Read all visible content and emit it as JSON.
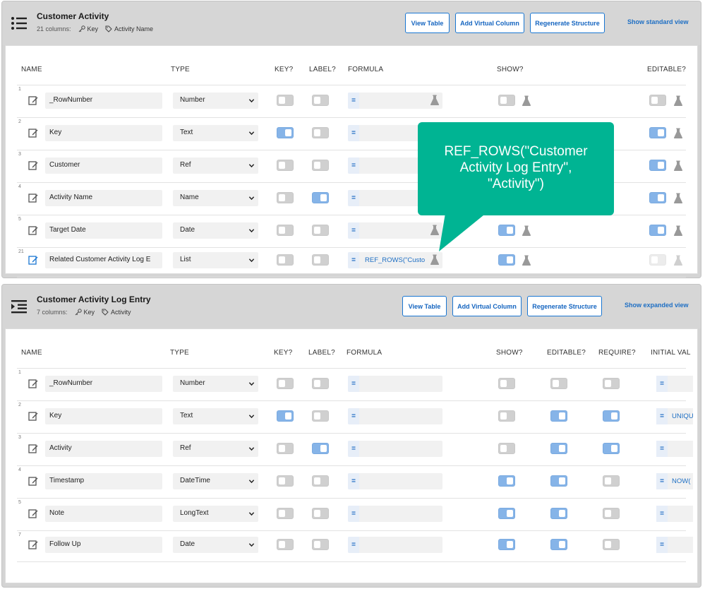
{
  "tables": [
    {
      "title": "Customer Activity",
      "columns_count": "21 columns:",
      "key_label": "Key",
      "label_label": "Activity Name",
      "buttons": {
        "view_table": "View Table",
        "add_virtual": "Add Virtual Column",
        "regenerate": "Regenerate Structure"
      },
      "toggle_view_link": "Show standard view",
      "headers": {
        "name": "NAME",
        "type": "TYPE",
        "key": "KEY?",
        "label": "LABEL?",
        "formula": "FORMULA",
        "show": "SHOW?",
        "editable": "EDITABLE?"
      },
      "rows": [
        {
          "num": "1",
          "name": "_RowNumber",
          "type": "Number",
          "key": false,
          "label": false,
          "formula": "",
          "show": false,
          "editable": false
        },
        {
          "num": "2",
          "name": "Key",
          "type": "Text",
          "key": true,
          "label": false,
          "formula": "",
          "show": null,
          "editable": true
        },
        {
          "num": "3",
          "name": "Customer",
          "type": "Ref",
          "key": false,
          "label": false,
          "formula": "",
          "show": null,
          "editable": true
        },
        {
          "num": "4",
          "name": "Activity Name",
          "type": "Name",
          "key": false,
          "label": true,
          "formula": "",
          "show": null,
          "editable": true
        },
        {
          "num": "5",
          "name": "Target Date",
          "type": "Date",
          "key": false,
          "label": false,
          "formula": "",
          "show": true,
          "editable": true
        },
        {
          "num": "21",
          "name": "Related Customer Activity Log E",
          "type": "List",
          "key": false,
          "label": false,
          "formula": "REF_ROWS(\"Custo",
          "show": true,
          "editable": "disabled"
        }
      ]
    },
    {
      "title": "Customer Activity Log Entry",
      "columns_count": "7 columns:",
      "key_label": "Key",
      "label_label": "Activity",
      "buttons": {
        "view_table": "View Table",
        "add_virtual": "Add Virtual Column",
        "regenerate": "Regenerate Structure"
      },
      "toggle_view_link": "Show expanded view",
      "headers": {
        "name": "NAME",
        "type": "TYPE",
        "key": "KEY?",
        "label": "LABEL?",
        "formula": "FORMULA",
        "show": "SHOW?",
        "editable": "EDITABLE?",
        "require": "REQUIRE?",
        "initial": "INITIAL VAL"
      },
      "rows": [
        {
          "num": "1",
          "name": "_RowNumber",
          "type": "Number",
          "key": false,
          "label": false,
          "show": false,
          "editable": false,
          "require": false,
          "initial": ""
        },
        {
          "num": "2",
          "name": "Key",
          "type": "Text",
          "key": true,
          "label": false,
          "show": false,
          "editable": true,
          "require": true,
          "initial": "UNIQU"
        },
        {
          "num": "3",
          "name": "Activity",
          "type": "Ref",
          "key": false,
          "label": true,
          "show": false,
          "editable": true,
          "require": true,
          "initial": ""
        },
        {
          "num": "4",
          "name": "Timestamp",
          "type": "DateTime",
          "key": false,
          "label": false,
          "show": true,
          "editable": true,
          "require": false,
          "initial": "NOW("
        },
        {
          "num": "5",
          "name": "Note",
          "type": "LongText",
          "key": false,
          "label": false,
          "show": true,
          "editable": true,
          "require": false,
          "initial": ""
        },
        {
          "num": "7",
          "name": "Follow Up",
          "type": "Date",
          "key": false,
          "label": false,
          "show": true,
          "editable": true,
          "require": false,
          "initial": ""
        }
      ]
    }
  ],
  "tooltip": "REF_ROWS(\"Customer Activity Log Entry\", \"Activity\")",
  "eq_symbol": "=",
  "colors": {
    "accent": "#1976d2",
    "toggle_on": "#86b4e8",
    "callout": "#00b493"
  }
}
